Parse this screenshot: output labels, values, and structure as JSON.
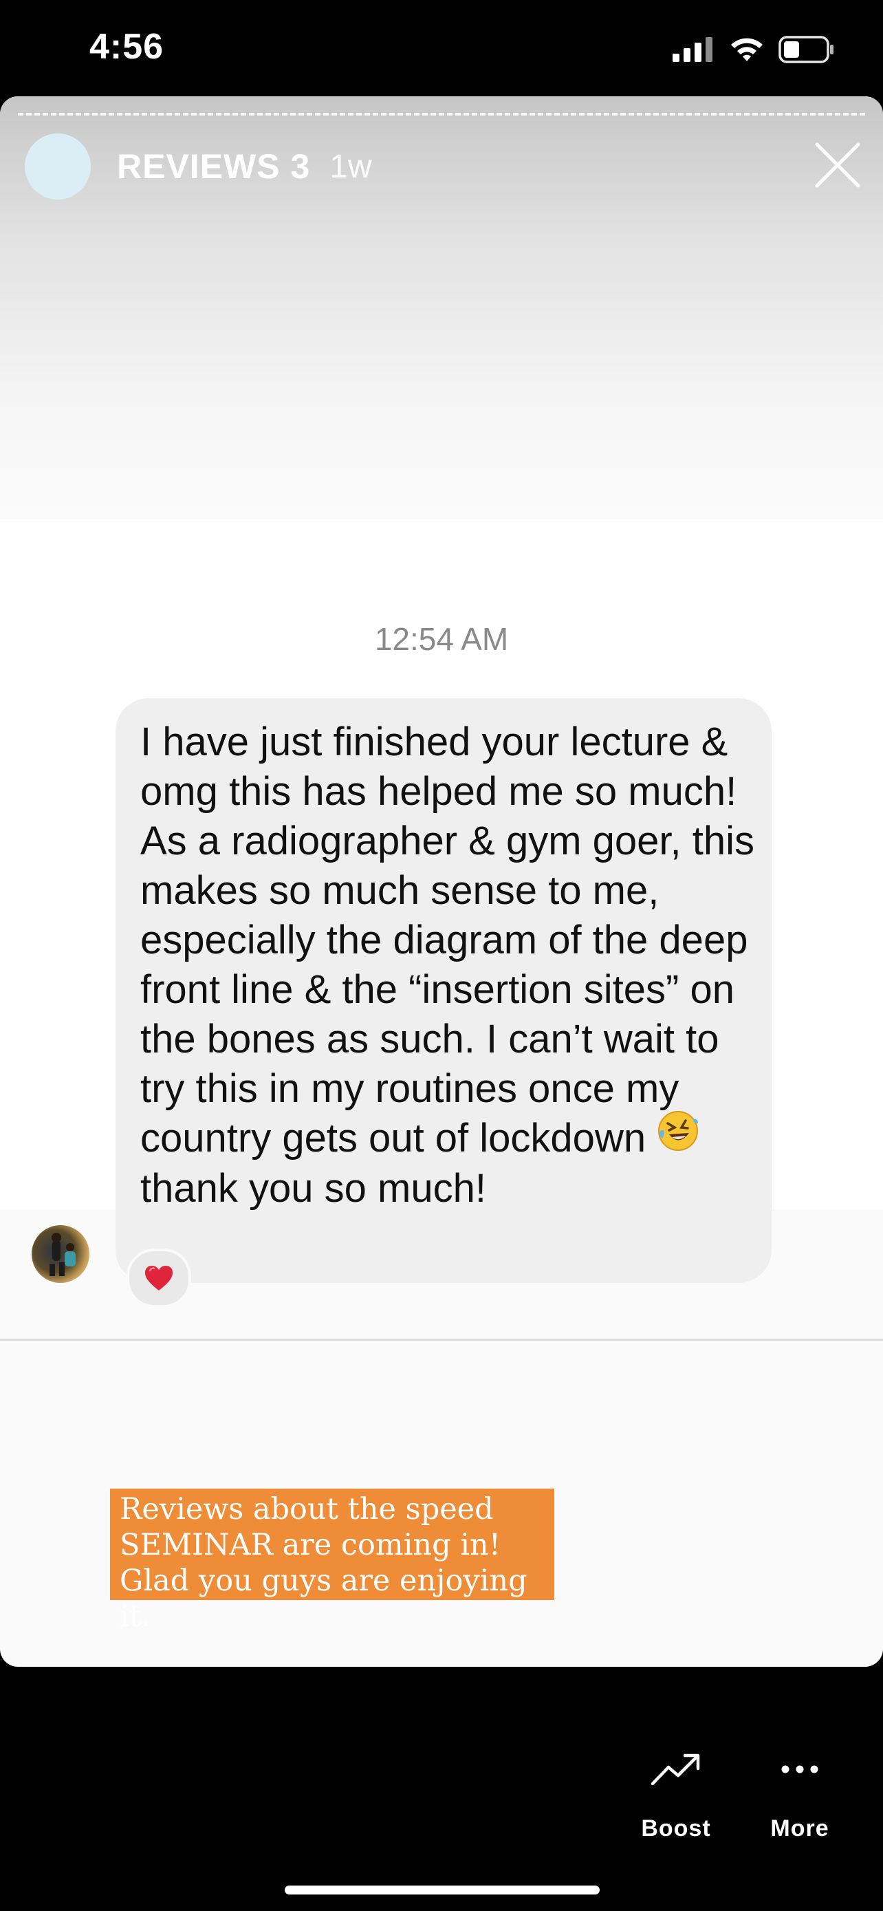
{
  "status_bar": {
    "time": "4:56",
    "icons": [
      "cellular-signal-icon",
      "wifi-icon",
      "battery-icon"
    ]
  },
  "story": {
    "title": "REVIEWS 3",
    "age": "1w",
    "close_icon": "close-icon"
  },
  "chat": {
    "timestamp": "12:54 AM",
    "message_before_emoji": "I have just finished your lecture & omg this has helped me so much! As a radiographer & gym goer, this makes so much sense to me, especially the diagram of the deep front line & the “insertion sites” on the bones as such. I can’t wait to try this in my routines once my country gets out of lockdown",
    "message_after_emoji": "thank you so much!",
    "emoji": "🤣",
    "reaction": "❤️"
  },
  "caption": {
    "text": "Reviews about the speed SEMINAR are coming in! Glad you guys are enjoying it."
  },
  "actions": [
    {
      "label": "Boost",
      "icon": "boost-trend-icon"
    },
    {
      "label": "More",
      "icon": "more-dots-icon"
    }
  ],
  "colors": {
    "caption_background": "#ee8c37",
    "bubble_background": "#efefef",
    "reaction_heart": "#e0243b"
  }
}
